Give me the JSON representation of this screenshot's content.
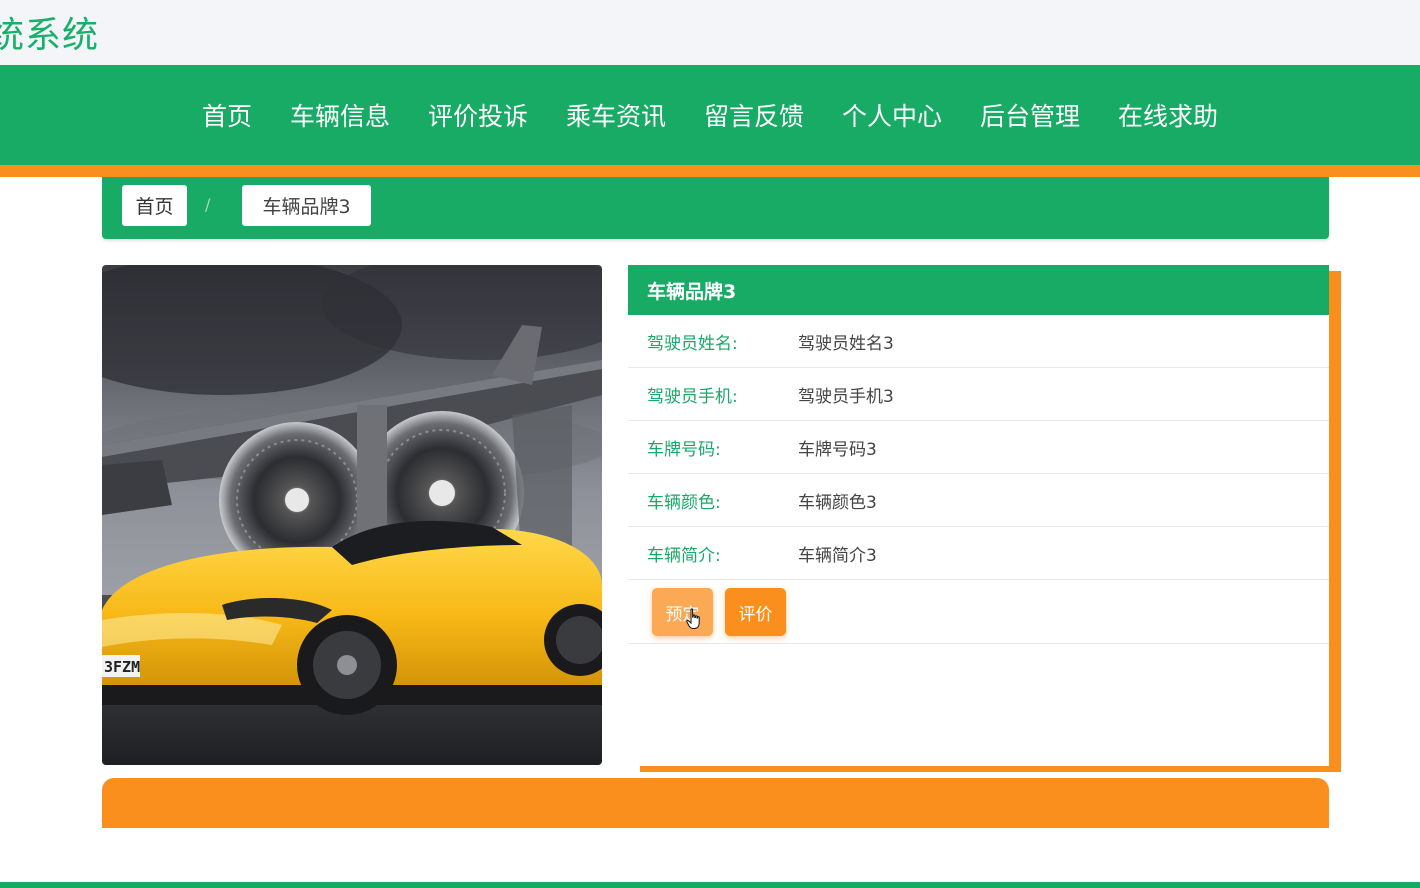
{
  "site": {
    "title": "统系统"
  },
  "nav": {
    "items": [
      {
        "label": "首页",
        "name": "nav-item-home"
      },
      {
        "label": "车辆信息",
        "name": "nav-item-vehicles"
      },
      {
        "label": "评价投诉",
        "name": "nav-item-reviews"
      },
      {
        "label": "乘车资讯",
        "name": "nav-item-news"
      },
      {
        "label": "留言反馈",
        "name": "nav-item-feedback"
      },
      {
        "label": "个人中心",
        "name": "nav-item-profile"
      },
      {
        "label": "后台管理",
        "name": "nav-item-admin"
      },
      {
        "label": "在线求助",
        "name": "nav-item-help"
      }
    ]
  },
  "breadcrumb": {
    "home": "首页",
    "separator": "/",
    "current": "车辆品牌3"
  },
  "detail": {
    "title": "车辆品牌3",
    "rows": [
      {
        "label": "驾驶员姓名:",
        "value": "驾驶员姓名3"
      },
      {
        "label": "驾驶员手机:",
        "value": "驾驶员手机3"
      },
      {
        "label": "车牌号码:",
        "value": "车牌号码3"
      },
      {
        "label": "车辆颜色:",
        "value": "车辆颜色3"
      },
      {
        "label": "车辆简介:",
        "value": "车辆简介3"
      }
    ],
    "book_label": "预定",
    "review_label": "评价"
  },
  "image": {
    "plate_text": "3FZM"
  },
  "colors": {
    "primary": "#17ab65",
    "accent": "#fb8f1d",
    "label": "#1aa868"
  }
}
